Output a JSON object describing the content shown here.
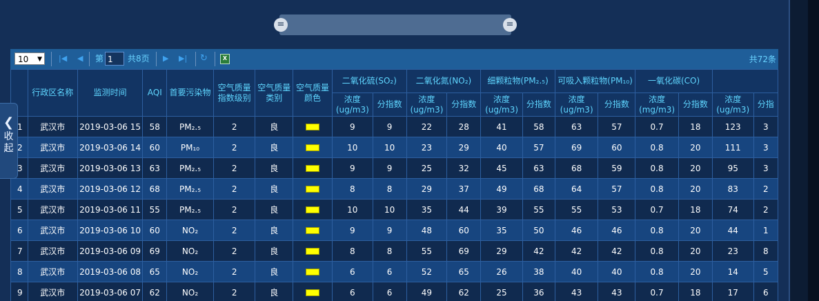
{
  "toolbar": {
    "page_size": "10",
    "page_prefix": "第",
    "current_page": "1",
    "page_suffix": "共8页",
    "total_records": "共72条",
    "excel_icon": "excel-export-icon"
  },
  "collapse": {
    "label": "收起",
    "char1": "收",
    "char2": "起"
  },
  "table": {
    "headers": {
      "district": "行政区名称",
      "time": "监测时间",
      "aqi": "AQI",
      "pollutant": "首要污染物",
      "level": "空气质量指数级别",
      "category": "空气质量类别",
      "color": "空气质量颜色",
      "so2": "二氧化硫(SO₂)",
      "no2": "二氧化氮(NO₂)",
      "pm25": "细颗粒物(PM₂.₅)",
      "pm10": "可吸入颗粒物(PM₁₀)",
      "co": "一氧化碳(CO)",
      "conc_ug": "浓度(ug/m3)",
      "conc_mg": "浓度(mg/m3)",
      "sub_index": "分指数",
      "sub_index_partial": "分指"
    },
    "rows": [
      {
        "no": "1",
        "district": "武汉市",
        "time": "2019-03-06 15",
        "aqi": "58",
        "pollutant": "PM₂.₅",
        "level": "2",
        "category": "良",
        "so2": "9",
        "so2i": "9",
        "no2": "22",
        "no2i": "28",
        "pm25": "41",
        "pm25i": "58",
        "pm10": "63",
        "pm10i": "57",
        "co": "0.7",
        "coi": "18",
        "o3": "123",
        "o3i": "3"
      },
      {
        "no": "2",
        "district": "武汉市",
        "time": "2019-03-06 14",
        "aqi": "60",
        "pollutant": "PM₁₀",
        "level": "2",
        "category": "良",
        "so2": "10",
        "so2i": "10",
        "no2": "23",
        "no2i": "29",
        "pm25": "40",
        "pm25i": "57",
        "pm10": "69",
        "pm10i": "60",
        "co": "0.8",
        "coi": "20",
        "o3": "111",
        "o3i": "3"
      },
      {
        "no": "3",
        "district": "武汉市",
        "time": "2019-03-06 13",
        "aqi": "63",
        "pollutant": "PM₂.₅",
        "level": "2",
        "category": "良",
        "so2": "9",
        "so2i": "9",
        "no2": "25",
        "no2i": "32",
        "pm25": "45",
        "pm25i": "63",
        "pm10": "68",
        "pm10i": "59",
        "co": "0.8",
        "coi": "20",
        "o3": "95",
        "o3i": "3"
      },
      {
        "no": "4",
        "district": "武汉市",
        "time": "2019-03-06 12",
        "aqi": "68",
        "pollutant": "PM₂.₅",
        "level": "2",
        "category": "良",
        "so2": "8",
        "so2i": "8",
        "no2": "29",
        "no2i": "37",
        "pm25": "49",
        "pm25i": "68",
        "pm10": "64",
        "pm10i": "57",
        "co": "0.8",
        "coi": "20",
        "o3": "83",
        "o3i": "2"
      },
      {
        "no": "5",
        "district": "武汉市",
        "time": "2019-03-06 11",
        "aqi": "55",
        "pollutant": "PM₂.₅",
        "level": "2",
        "category": "良",
        "so2": "10",
        "so2i": "10",
        "no2": "35",
        "no2i": "44",
        "pm25": "39",
        "pm25i": "55",
        "pm10": "55",
        "pm10i": "53",
        "co": "0.7",
        "coi": "18",
        "o3": "74",
        "o3i": "2"
      },
      {
        "no": "6",
        "district": "武汉市",
        "time": "2019-03-06 10",
        "aqi": "60",
        "pollutant": "NO₂",
        "level": "2",
        "category": "良",
        "so2": "9",
        "so2i": "9",
        "no2": "48",
        "no2i": "60",
        "pm25": "35",
        "pm25i": "50",
        "pm10": "46",
        "pm10i": "46",
        "co": "0.8",
        "coi": "20",
        "o3": "44",
        "o3i": "1"
      },
      {
        "no": "7",
        "district": "武汉市",
        "time": "2019-03-06 09",
        "aqi": "69",
        "pollutant": "NO₂",
        "level": "2",
        "category": "良",
        "so2": "8",
        "so2i": "8",
        "no2": "55",
        "no2i": "69",
        "pm25": "29",
        "pm25i": "42",
        "pm10": "42",
        "pm10i": "42",
        "co": "0.8",
        "coi": "20",
        "o3": "23",
        "o3i": "8"
      },
      {
        "no": "8",
        "district": "武汉市",
        "time": "2019-03-06 08",
        "aqi": "65",
        "pollutant": "NO₂",
        "level": "2",
        "category": "良",
        "so2": "6",
        "so2i": "6",
        "no2": "52",
        "no2i": "65",
        "pm25": "26",
        "pm25i": "38",
        "pm10": "40",
        "pm10i": "40",
        "co": "0.8",
        "coi": "20",
        "o3": "14",
        "o3i": "5"
      },
      {
        "no": "9",
        "district": "武汉市",
        "time": "2019-03-06 07",
        "aqi": "62",
        "pollutant": "NO₂",
        "level": "2",
        "category": "良",
        "so2": "6",
        "so2i": "6",
        "no2": "49",
        "no2i": "62",
        "pm25": "25",
        "pm25i": "36",
        "pm10": "43",
        "pm10i": "43",
        "co": "0.7",
        "coi": "18",
        "o3": "17",
        "o3i": "6"
      }
    ]
  },
  "colors": {
    "background": "#142f57",
    "row_odd": "#102a4f",
    "row_even": "#17457f",
    "header_text": "#5fd6ff",
    "quality_good": "#ffff00"
  }
}
